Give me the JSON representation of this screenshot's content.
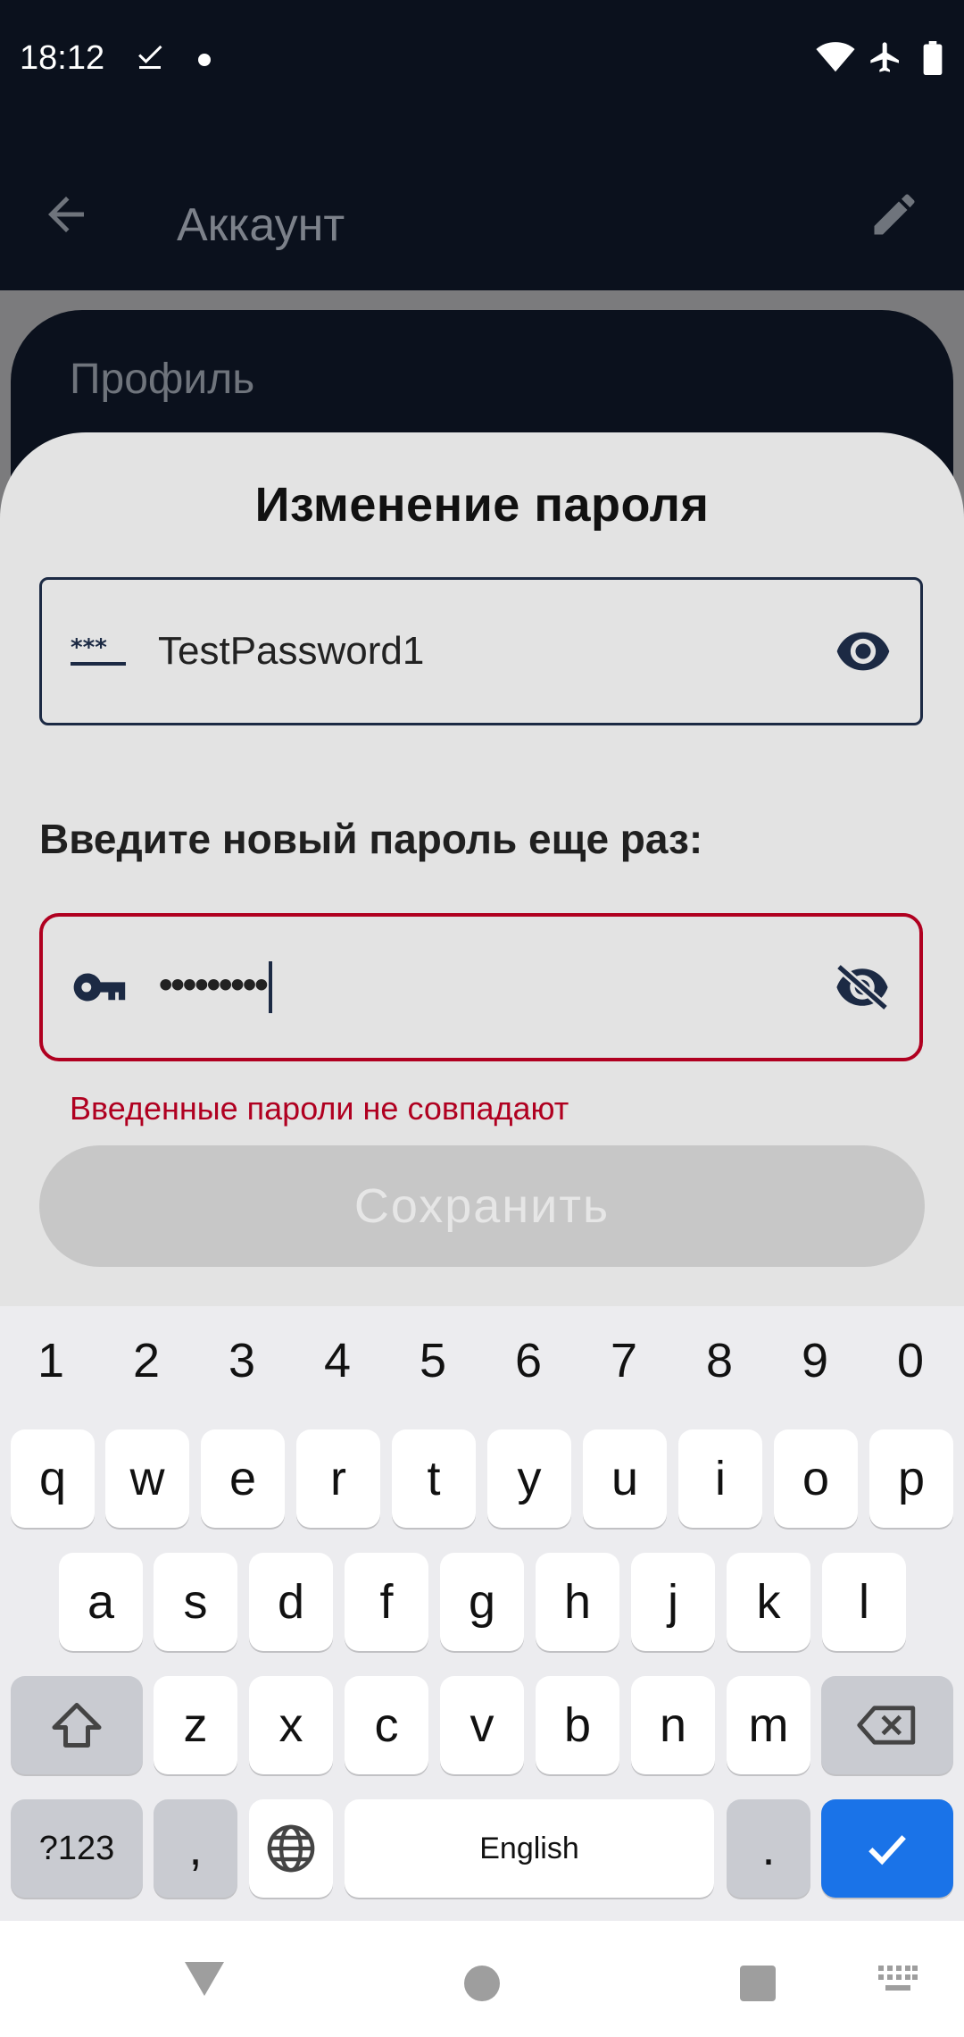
{
  "status_bar": {
    "time": "18:12"
  },
  "app_bar": {
    "title": "Аккаунт"
  },
  "background": {
    "profile_title": "Профиль"
  },
  "sheet": {
    "title": "Изменение пароля",
    "new_password_value": "TestPassword1",
    "repeat_label": "Введите новый пароль еще раз:",
    "repeat_password_masked": "•••••••••",
    "error": "Введенные пароли не совпадают",
    "save_label": "Сохранить"
  },
  "keyboard": {
    "numbers": [
      "1",
      "2",
      "3",
      "4",
      "5",
      "6",
      "7",
      "8",
      "9",
      "0"
    ],
    "row1": [
      "q",
      "w",
      "e",
      "r",
      "t",
      "y",
      "u",
      "i",
      "o",
      "p"
    ],
    "row2": [
      "a",
      "s",
      "d",
      "f",
      "g",
      "h",
      "j",
      "k",
      "l"
    ],
    "row3": [
      "z",
      "x",
      "c",
      "v",
      "b",
      "n",
      "m"
    ],
    "symbols_label": "?123",
    "comma": ",",
    "space_label": "English",
    "period": "."
  },
  "colors": {
    "dark": "#0b111d",
    "error": "#b00020",
    "accent": "#1a73e8"
  }
}
